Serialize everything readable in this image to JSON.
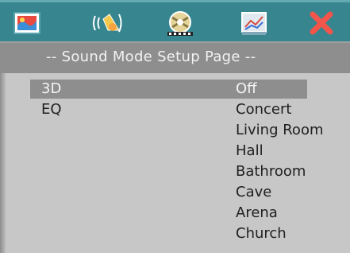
{
  "toolbar": {
    "icons": [
      {
        "name": "general-setup-icon"
      },
      {
        "name": "audio-setup-icon"
      },
      {
        "name": "video-setup-icon"
      },
      {
        "name": "preference-setup-icon"
      },
      {
        "name": "exit-icon"
      }
    ]
  },
  "page": {
    "title": "-- Sound Mode Setup Page --"
  },
  "settings": [
    {
      "label": "3D",
      "value": "Off",
      "selected": true
    },
    {
      "label": "EQ"
    }
  ],
  "options": [
    "Off",
    "Concert",
    "Living Room",
    "Hall",
    "Bathroom",
    "Cave",
    "Arena",
    "Church"
  ],
  "colors": {
    "toolbar": "#37868f",
    "title_bar": "#8e8e8e",
    "panel": "#c7c7c7",
    "highlight": "#8e8e8e",
    "exit": "#f4554b"
  }
}
